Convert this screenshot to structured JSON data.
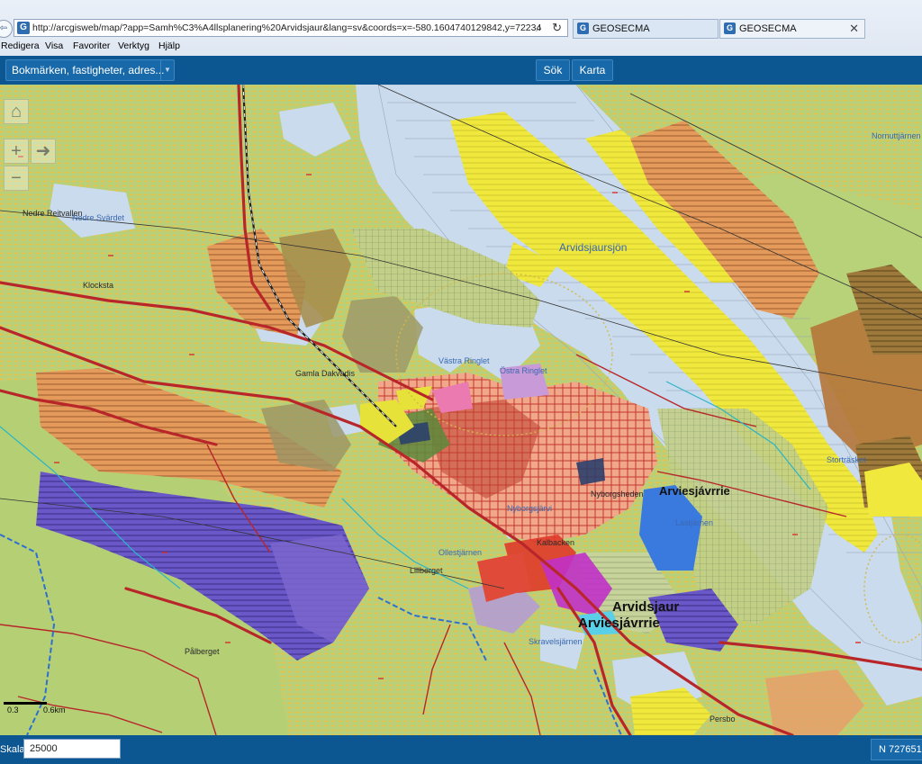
{
  "browser": {
    "url": "http://arcgisweb/map/?app=Samh%C3%A4llsplanering%20Arvidsjaur&lang=sv&coords=x=-580.1604740129842,y=7223455.72242",
    "tabs": [
      {
        "label": "GEOSECMA",
        "icon": "geosecma-favicon"
      },
      {
        "label": "GEOSECMA",
        "icon": "geosecma-favicon"
      }
    ],
    "menu": [
      "Redigera",
      "Visa",
      "Favoriter",
      "Verktyg",
      "Hjälp"
    ]
  },
  "toolbar": {
    "search_placeholder": "Bokmärken, fastigheter, adres...",
    "sok_label": "Sök",
    "karta_label": "Karta",
    "accent": "#0c5691"
  },
  "map_labels": {
    "arvidsjaur": "Arvidsjaur",
    "arviesjavrrie_1": "Arviesjávrrie",
    "arviesjavrrie_2": "Arviesjávrrie",
    "arvidsjaursjon": "Arvidsjaursjön",
    "nybergsheden": "Nyborgsheden",
    "lillberget": "Lillberget",
    "nedre_svardet": "Nedre Svärdet",
    "nedre_rentvallen": "Nedre Reitvallen",
    "klocksta": "Klocksta",
    "gamla_dakvadis": "Gamla Dakvadis",
    "vastra_ringlet": "Västra Ringlet",
    "ostra_ringlet": "Östra Ringlet",
    "nyborgsjarvi": "Nyborgsjärvi",
    "kalbacken": "Kalbacken",
    "ollestjarnen": "Ollestjärnen",
    "skravelsjarnen": "Skravelsjärnen",
    "pallberget": "Pålberget",
    "nordtjarnen": "Nornuttjärnen",
    "sturkvallen": "Storträsket",
    "lastjarnen": "Lastjärnen",
    "persbo": "Persbo"
  },
  "map_controls": {
    "home_icon": "home-icon",
    "zoom_in_icon": "plus-icon",
    "pan_icon": "arrow-right-icon",
    "zoom_out_icon": "minus-icon"
  },
  "scalebar": {
    "left": "0.3",
    "right": "0.6km"
  },
  "statusbar": {
    "scale_label": "Skala▴",
    "scale_value": "25000",
    "coordinate": "N 727651"
  }
}
